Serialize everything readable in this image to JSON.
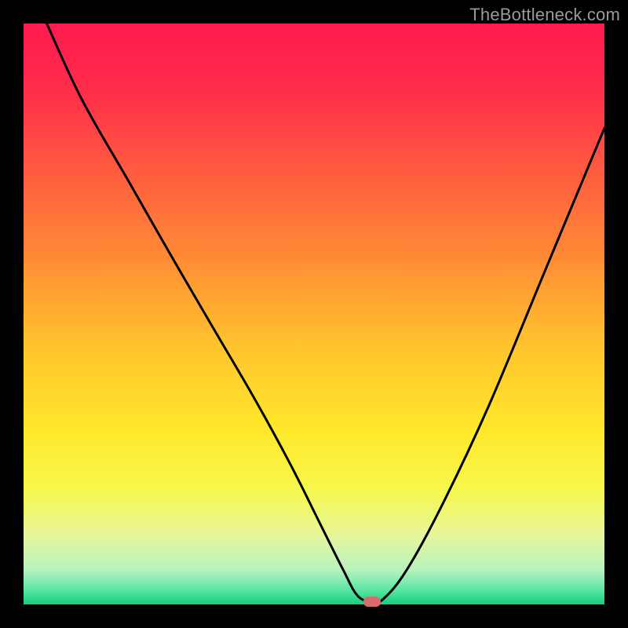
{
  "watermark": "TheBottleneck.com",
  "gradient": {
    "stops": [
      {
        "offset": 0.0,
        "color": "#ff1a4f"
      },
      {
        "offset": 0.12,
        "color": "#ff2e4a"
      },
      {
        "offset": 0.25,
        "color": "#ff5a3f"
      },
      {
        "offset": 0.4,
        "color": "#ff8a35"
      },
      {
        "offset": 0.55,
        "color": "#ffc22e"
      },
      {
        "offset": 0.7,
        "color": "#ffe82a"
      },
      {
        "offset": 0.8,
        "color": "#f7f74c"
      },
      {
        "offset": 0.88,
        "color": "#e6f79a"
      },
      {
        "offset": 0.94,
        "color": "#b8f2bf"
      },
      {
        "offset": 0.975,
        "color": "#59e6a3"
      },
      {
        "offset": 1.0,
        "color": "#12d07d"
      }
    ]
  },
  "chart_data": {
    "type": "line",
    "title": "",
    "xlabel": "",
    "ylabel": "",
    "xlim": [
      0,
      100
    ],
    "ylim": [
      0,
      100
    ],
    "series": [
      {
        "name": "bottleneck-curve",
        "x": [
          4,
          10,
          18,
          26,
          33,
          40,
          46,
          51,
          55,
          57.5,
          60,
          62,
          66,
          72,
          80,
          90,
          100
        ],
        "y": [
          100,
          87,
          73,
          59,
          47,
          35,
          24,
          14,
          6,
          1.5,
          0.5,
          1,
          6,
          17,
          34,
          58,
          82
        ]
      }
    ],
    "marker": {
      "x": 60,
      "y": 0.5,
      "w": 3.1,
      "h": 1.7
    }
  },
  "colors": {
    "curve": "#000000",
    "marker": "#d76a6a",
    "frame": "#000000"
  }
}
